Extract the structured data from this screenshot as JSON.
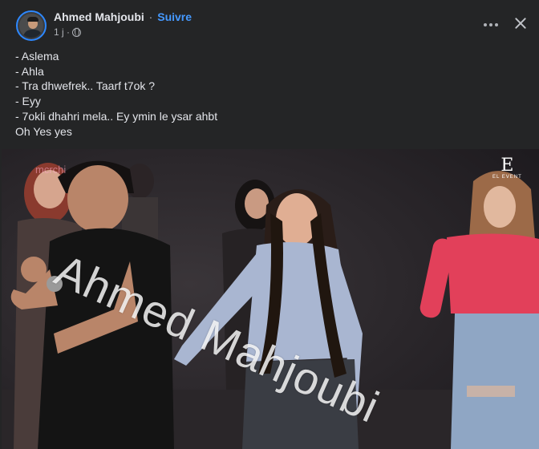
{
  "post": {
    "author": "Ahmed Mahjoubi",
    "separator": "·",
    "follow_label": "Suivre",
    "timestamp": "1 j ·",
    "privacy_icon": "globe-icon",
    "text_lines": [
      "- Aslema",
      "- Ahla",
      "- Tra dhwefrek.. Taarf t7ok ?",
      "- Eyy",
      "- 7okli dhahri mela.. Ey ymin le ysar ahbt",
      "Oh Yes yes"
    ],
    "actions": {
      "more_icon": "more-icon",
      "close_icon": "close-icon"
    }
  },
  "media": {
    "watermark": "Ahmed Mahjoubi",
    "corner_mark": "mcrchi",
    "event_logo": {
      "letter": "E",
      "caption": "EL EVENT"
    }
  },
  "colors": {
    "background": "#242526",
    "link": "#4599ff",
    "secondary_text": "#b0b3b8"
  }
}
